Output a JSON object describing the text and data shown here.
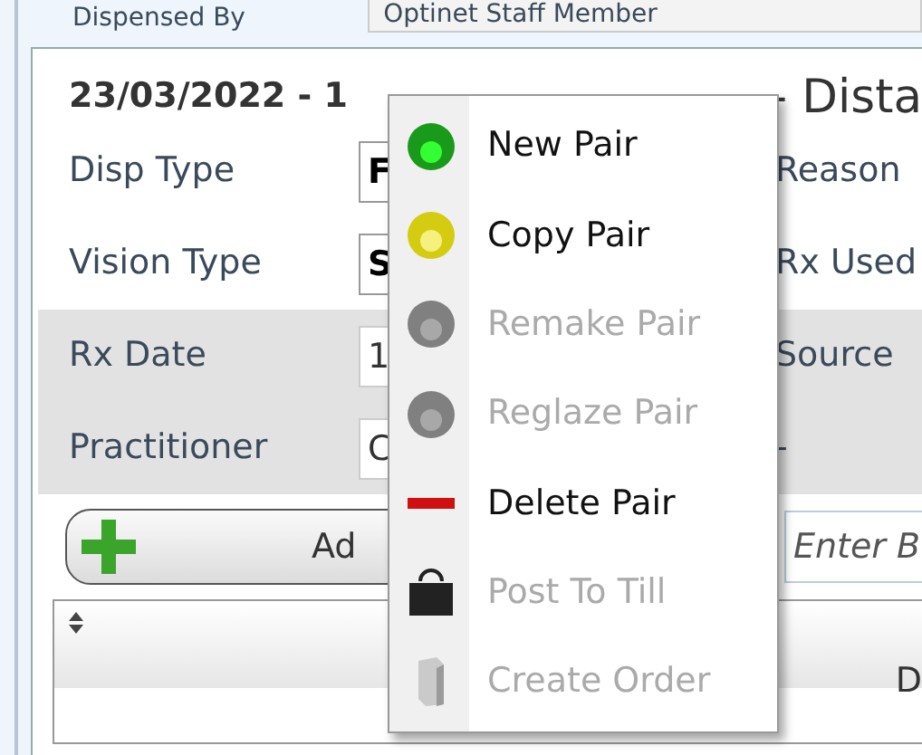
{
  "dispensed_by": {
    "label": "Dispensed By",
    "value": "Optinet Staff Member"
  },
  "dispense": {
    "heading_start": "23/03/2022 - 1",
    "heading_end": "- Dista",
    "rows": [
      {
        "label": "Disp Type",
        "value": "F",
        "right_label": "Reason",
        "shaded": false
      },
      {
        "label": "Vision Type",
        "value": "S",
        "right_label": "Rx Used",
        "shaded": false
      },
      {
        "label": "Rx Date",
        "value": "1",
        "right_label": "Source",
        "shaded": true
      },
      {
        "label": "Practitioner",
        "value": "C",
        "right_label": "-",
        "shaded": true
      }
    ],
    "add_button": {
      "label": "Ad"
    },
    "barcode_field": {
      "placeholder": "Enter B"
    },
    "table": {
      "columns": [
        "D"
      ]
    }
  },
  "context_menu": [
    {
      "label": "New Pair",
      "kind": "go",
      "disabled": false
    },
    {
      "label": "Copy Pair",
      "kind": "copy",
      "disabled": false
    },
    {
      "label": "Remake Pair",
      "kind": "remake",
      "disabled": true
    },
    {
      "label": "Reglaze Pair",
      "kind": "reglaze",
      "disabled": true
    },
    {
      "label": "Delete Pair",
      "kind": "delete",
      "disabled": false
    },
    {
      "label": "Post To Till",
      "kind": "till",
      "disabled": true
    },
    {
      "label": "Create Order",
      "kind": "order",
      "disabled": true
    }
  ]
}
